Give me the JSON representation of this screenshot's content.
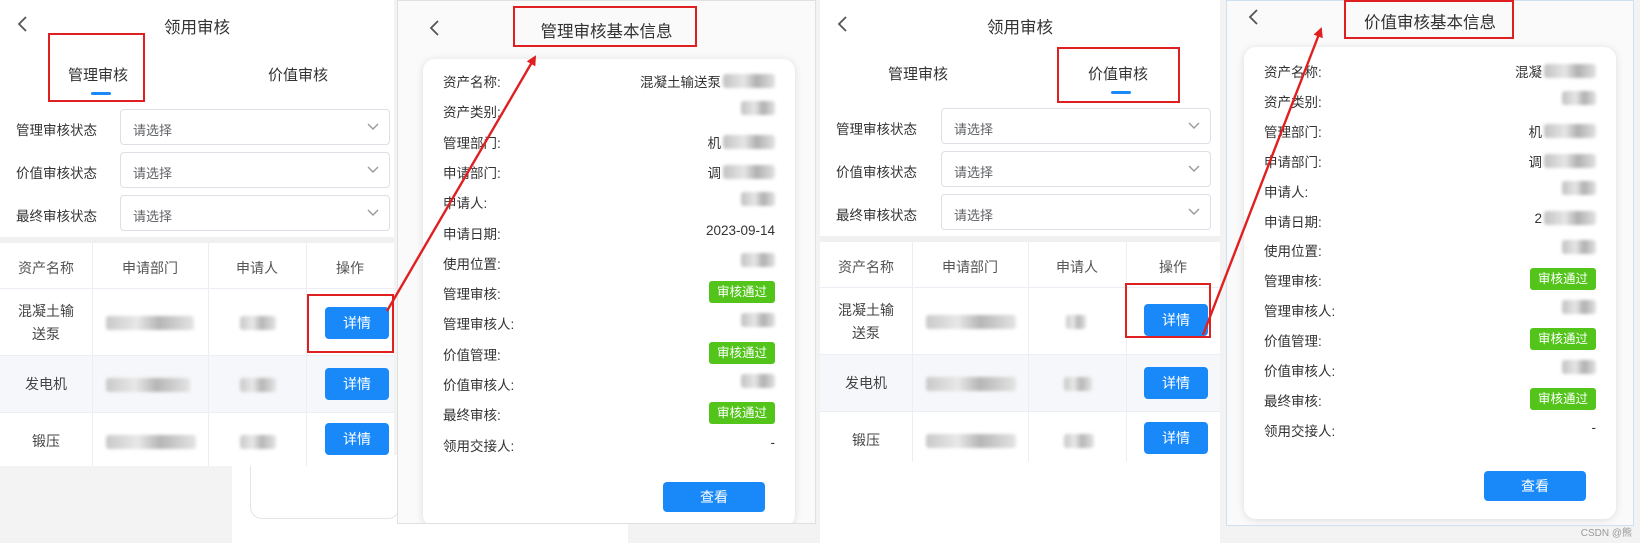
{
  "list_manage": {
    "title": "领用审核",
    "tabs": [
      "管理审核",
      "价值审核"
    ],
    "active_tab": 0,
    "filters": [
      {
        "label": "管理审核状态",
        "placeholder": "请选择"
      },
      {
        "label": "价值审核状态",
        "placeholder": "请选择"
      },
      {
        "label": "最终审核状态",
        "placeholder": "请选择"
      }
    ],
    "columns": [
      "资产名称",
      "申请部门",
      "申请人",
      "操作"
    ],
    "rows": [
      {
        "name": "混凝土输送泵",
        "name_lines": [
          "混凝土输",
          "送泵"
        ],
        "action": "详情"
      },
      {
        "name": "发电机",
        "name_lines": [
          "发电机"
        ],
        "action": "详情"
      },
      {
        "name": "锻压",
        "name_lines": [
          "锻压"
        ],
        "action": "详情"
      }
    ]
  },
  "detail_manage": {
    "title": "管理审核基本信息",
    "fields": [
      {
        "label": "资产名称:",
        "value": "混凝土输送泵",
        "kind": "blur"
      },
      {
        "label": "资产类别:",
        "value": "",
        "kind": "blur"
      },
      {
        "label": "管理部门:",
        "value": "机",
        "kind": "blur"
      },
      {
        "label": "申请部门:",
        "value": "调",
        "kind": "blur"
      },
      {
        "label": "申请人:",
        "value": "",
        "kind": "blur"
      },
      {
        "label": "申请日期:",
        "value": "2023-09-14",
        "kind": "text"
      },
      {
        "label": "使用位置:",
        "value": "",
        "kind": "blur"
      },
      {
        "label": "管理审核:",
        "value": "审核通过",
        "kind": "badge"
      },
      {
        "label": "管理审核人:",
        "value": "",
        "kind": "blur"
      },
      {
        "label": "价值管理:",
        "value": "审核通过",
        "kind": "badge"
      },
      {
        "label": "价值审核人:",
        "value": "",
        "kind": "blur"
      },
      {
        "label": "最终审核:",
        "value": "审核通过",
        "kind": "badge"
      },
      {
        "label": "领用交接人:",
        "value": "-",
        "kind": "text"
      }
    ],
    "button": "查看"
  },
  "list_value": {
    "title": "领用审核",
    "tabs": [
      "管理审核",
      "价值审核"
    ],
    "active_tab": 1,
    "filters": [
      {
        "label": "管理审核状态",
        "placeholder": "请选择"
      },
      {
        "label": "价值审核状态",
        "placeholder": "请选择"
      },
      {
        "label": "最终审核状态",
        "placeholder": "请选择"
      }
    ],
    "columns": [
      "资产名称",
      "申请部门",
      "申请人",
      "操作"
    ],
    "rows": [
      {
        "name": "混凝土输送泵",
        "name_lines": [
          "混凝土输",
          "送泵"
        ],
        "action": "详情"
      },
      {
        "name": "发电机",
        "name_lines": [
          "发电机"
        ],
        "action": "详情"
      },
      {
        "name": "锻压",
        "name_lines": [
          "锻压"
        ],
        "action": "详情"
      }
    ]
  },
  "detail_value": {
    "title": "价值审核基本信息",
    "fields": [
      {
        "label": "资产名称:",
        "value": "混凝",
        "kind": "blur"
      },
      {
        "label": "资产类别:",
        "value": "",
        "kind": "blur"
      },
      {
        "label": "管理部门:",
        "value": "机",
        "kind": "blur"
      },
      {
        "label": "申请部门:",
        "value": "调",
        "kind": "blur"
      },
      {
        "label": "申请人:",
        "value": "",
        "kind": "blur"
      },
      {
        "label": "申请日期:",
        "value": "2",
        "kind": "blur"
      },
      {
        "label": "使用位置:",
        "value": "",
        "kind": "blur"
      },
      {
        "label": "管理审核:",
        "value": "审核通过",
        "kind": "badge"
      },
      {
        "label": "管理审核人:",
        "value": "",
        "kind": "blur"
      },
      {
        "label": "价值管理:",
        "value": "审核通过",
        "kind": "badge"
      },
      {
        "label": "价值审核人:",
        "value": "",
        "kind": "blur"
      },
      {
        "label": "最终审核:",
        "value": "审核通过",
        "kind": "badge"
      },
      {
        "label": "领用交接人:",
        "value": "-",
        "kind": "text"
      }
    ],
    "button": "查看"
  },
  "watermark": "CSDN @熊",
  "colors": {
    "primary": "#1989fa",
    "success": "#52c41a",
    "annotation": "#e02020"
  }
}
